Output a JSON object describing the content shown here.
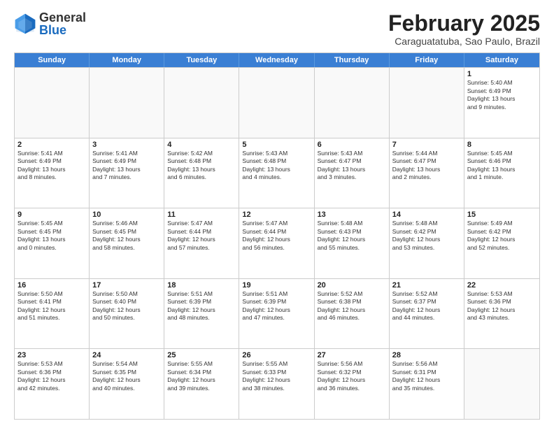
{
  "logo": {
    "general": "General",
    "blue": "Blue"
  },
  "title": "February 2025",
  "subtitle": "Caraguatatuba, Sao Paulo, Brazil",
  "header_days": [
    "Sunday",
    "Monday",
    "Tuesday",
    "Wednesday",
    "Thursday",
    "Friday",
    "Saturday"
  ],
  "weeks": [
    [
      {
        "day": "",
        "info": ""
      },
      {
        "day": "",
        "info": ""
      },
      {
        "day": "",
        "info": ""
      },
      {
        "day": "",
        "info": ""
      },
      {
        "day": "",
        "info": ""
      },
      {
        "day": "",
        "info": ""
      },
      {
        "day": "1",
        "info": "Sunrise: 5:40 AM\nSunset: 6:49 PM\nDaylight: 13 hours\nand 9 minutes."
      }
    ],
    [
      {
        "day": "2",
        "info": "Sunrise: 5:41 AM\nSunset: 6:49 PM\nDaylight: 13 hours\nand 8 minutes."
      },
      {
        "day": "3",
        "info": "Sunrise: 5:41 AM\nSunset: 6:49 PM\nDaylight: 13 hours\nand 7 minutes."
      },
      {
        "day": "4",
        "info": "Sunrise: 5:42 AM\nSunset: 6:48 PM\nDaylight: 13 hours\nand 6 minutes."
      },
      {
        "day": "5",
        "info": "Sunrise: 5:43 AM\nSunset: 6:48 PM\nDaylight: 13 hours\nand 4 minutes."
      },
      {
        "day": "6",
        "info": "Sunrise: 5:43 AM\nSunset: 6:47 PM\nDaylight: 13 hours\nand 3 minutes."
      },
      {
        "day": "7",
        "info": "Sunrise: 5:44 AM\nSunset: 6:47 PM\nDaylight: 13 hours\nand 2 minutes."
      },
      {
        "day": "8",
        "info": "Sunrise: 5:45 AM\nSunset: 6:46 PM\nDaylight: 13 hours\nand 1 minute."
      }
    ],
    [
      {
        "day": "9",
        "info": "Sunrise: 5:45 AM\nSunset: 6:45 PM\nDaylight: 13 hours\nand 0 minutes."
      },
      {
        "day": "10",
        "info": "Sunrise: 5:46 AM\nSunset: 6:45 PM\nDaylight: 12 hours\nand 58 minutes."
      },
      {
        "day": "11",
        "info": "Sunrise: 5:47 AM\nSunset: 6:44 PM\nDaylight: 12 hours\nand 57 minutes."
      },
      {
        "day": "12",
        "info": "Sunrise: 5:47 AM\nSunset: 6:44 PM\nDaylight: 12 hours\nand 56 minutes."
      },
      {
        "day": "13",
        "info": "Sunrise: 5:48 AM\nSunset: 6:43 PM\nDaylight: 12 hours\nand 55 minutes."
      },
      {
        "day": "14",
        "info": "Sunrise: 5:48 AM\nSunset: 6:42 PM\nDaylight: 12 hours\nand 53 minutes."
      },
      {
        "day": "15",
        "info": "Sunrise: 5:49 AM\nSunset: 6:42 PM\nDaylight: 12 hours\nand 52 minutes."
      }
    ],
    [
      {
        "day": "16",
        "info": "Sunrise: 5:50 AM\nSunset: 6:41 PM\nDaylight: 12 hours\nand 51 minutes."
      },
      {
        "day": "17",
        "info": "Sunrise: 5:50 AM\nSunset: 6:40 PM\nDaylight: 12 hours\nand 50 minutes."
      },
      {
        "day": "18",
        "info": "Sunrise: 5:51 AM\nSunset: 6:39 PM\nDaylight: 12 hours\nand 48 minutes."
      },
      {
        "day": "19",
        "info": "Sunrise: 5:51 AM\nSunset: 6:39 PM\nDaylight: 12 hours\nand 47 minutes."
      },
      {
        "day": "20",
        "info": "Sunrise: 5:52 AM\nSunset: 6:38 PM\nDaylight: 12 hours\nand 46 minutes."
      },
      {
        "day": "21",
        "info": "Sunrise: 5:52 AM\nSunset: 6:37 PM\nDaylight: 12 hours\nand 44 minutes."
      },
      {
        "day": "22",
        "info": "Sunrise: 5:53 AM\nSunset: 6:36 PM\nDaylight: 12 hours\nand 43 minutes."
      }
    ],
    [
      {
        "day": "23",
        "info": "Sunrise: 5:53 AM\nSunset: 6:36 PM\nDaylight: 12 hours\nand 42 minutes."
      },
      {
        "day": "24",
        "info": "Sunrise: 5:54 AM\nSunset: 6:35 PM\nDaylight: 12 hours\nand 40 minutes."
      },
      {
        "day": "25",
        "info": "Sunrise: 5:55 AM\nSunset: 6:34 PM\nDaylight: 12 hours\nand 39 minutes."
      },
      {
        "day": "26",
        "info": "Sunrise: 5:55 AM\nSunset: 6:33 PM\nDaylight: 12 hours\nand 38 minutes."
      },
      {
        "day": "27",
        "info": "Sunrise: 5:56 AM\nSunset: 6:32 PM\nDaylight: 12 hours\nand 36 minutes."
      },
      {
        "day": "28",
        "info": "Sunrise: 5:56 AM\nSunset: 6:31 PM\nDaylight: 12 hours\nand 35 minutes."
      },
      {
        "day": "",
        "info": ""
      }
    ]
  ]
}
